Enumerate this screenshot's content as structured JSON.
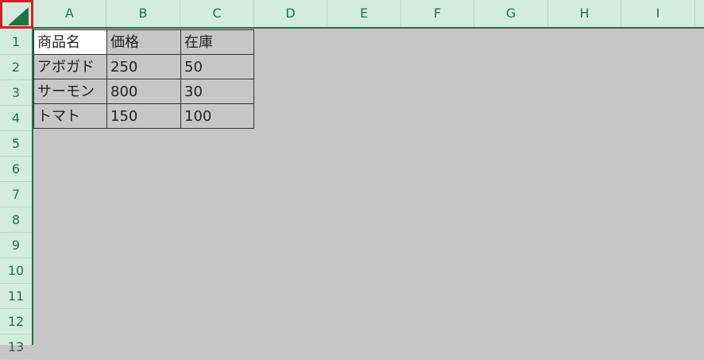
{
  "columns": [
    "A",
    "B",
    "C",
    "D",
    "E",
    "F",
    "G",
    "H",
    "I"
  ],
  "rows": [
    "1",
    "2",
    "3",
    "4",
    "5",
    "6",
    "7",
    "8",
    "9",
    "10",
    "11",
    "12",
    "13"
  ],
  "table": [
    [
      "商品名",
      "価格",
      "在庫"
    ],
    [
      "アボガド",
      "250",
      "50"
    ],
    [
      "サーモン",
      "800",
      "30"
    ],
    [
      "トマト",
      "150",
      "100"
    ]
  ],
  "colors": {
    "header_bg": "#d3ecdd",
    "header_text": "#217346",
    "accent_green": "#217346",
    "highlight_red": "#e11b22",
    "sheet_bg": "#c6c6c6"
  },
  "icons": {
    "select_all": "select-all-triangle-icon"
  }
}
